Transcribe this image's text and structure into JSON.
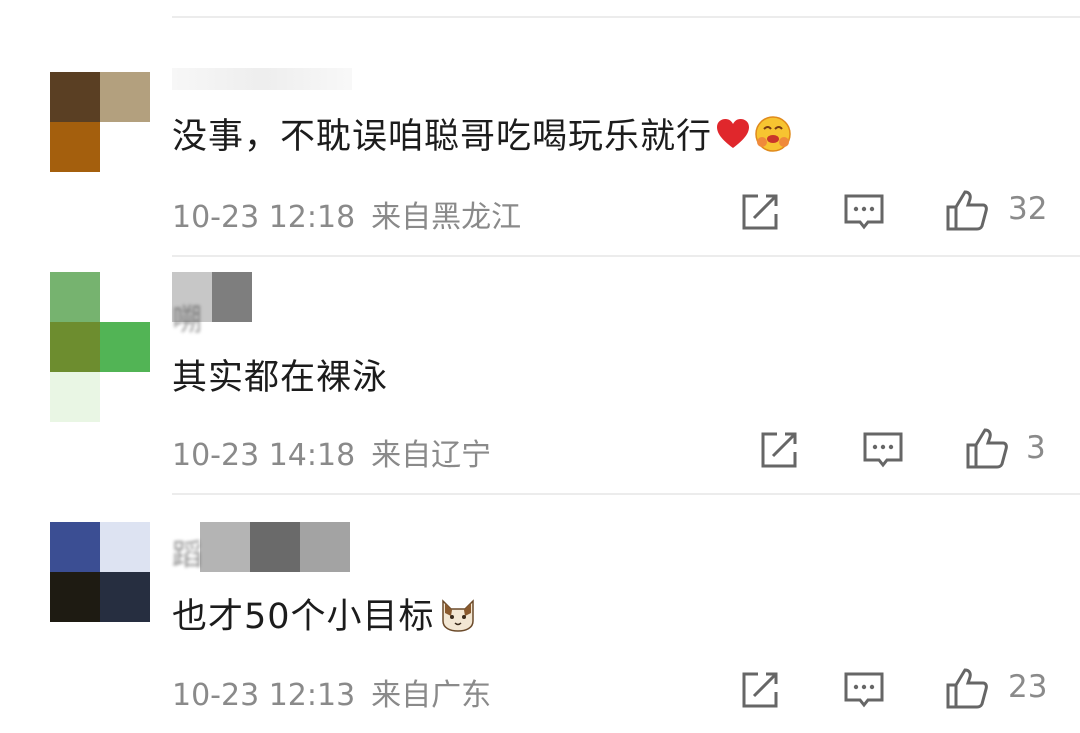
{
  "comments": [
    {
      "username_partial": "",
      "text": "没事，不耽误咱聪哥吃喝玩乐就行",
      "emojis": [
        "heart-icon",
        "hug-face-icon"
      ],
      "date": "10-23 12:18",
      "location": "来自黑龙江",
      "likes": "32",
      "avatar_colors": [
        "#5a3f23",
        "#b3a07e",
        "#a45f0d",
        "#ffffff"
      ]
    },
    {
      "username_partial": "嗍",
      "text": "其实都在裸泳",
      "emojis": [],
      "date": "10-23 14:18",
      "location": "来自辽宁",
      "likes": "3",
      "avatar_colors": [
        "#76b36f",
        "#ffffff",
        "#6d8d2f",
        "#52b455"
      ]
    },
    {
      "username_partial": "蹈",
      "text": "也才50个小目标",
      "emojis": [
        "cat-face-icon"
      ],
      "date": "10-23 12:13",
      "location": "来自广东",
      "likes": "23",
      "avatar_colors": [
        "#3b4e93",
        "#dde3f2",
        "#1e1b12",
        "#262e40"
      ]
    }
  ],
  "colors": {
    "divider": "#ececec",
    "meta_text": "#8a8a8a",
    "body_text": "#1c1c1c"
  }
}
